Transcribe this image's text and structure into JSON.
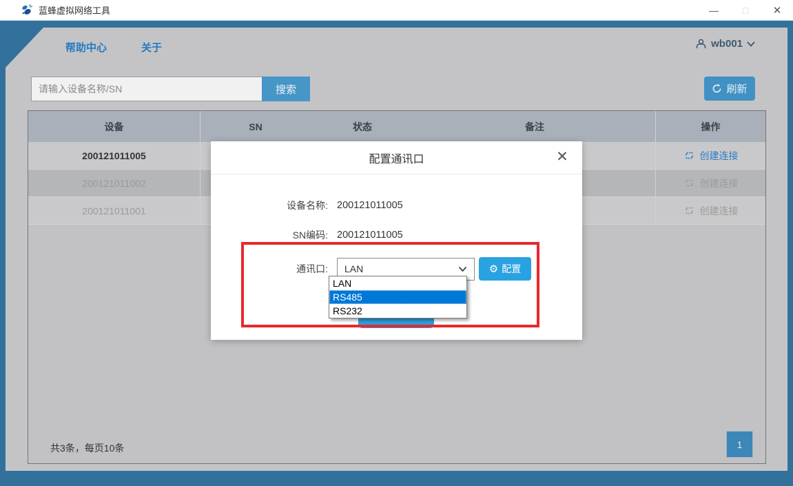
{
  "window": {
    "title": "蓝蜂虚拟网络工具",
    "controls": {
      "minimize": "—",
      "maximize": "□",
      "close": "✕"
    }
  },
  "navbar": {
    "tabs": [
      {
        "label": "帮助中心"
      },
      {
        "label": "关于"
      }
    ],
    "user": {
      "name": "wb001"
    }
  },
  "toolbar": {
    "search_placeholder": "请输入设备名称/SN",
    "search_label": "搜索",
    "refresh_label": "刷新"
  },
  "table": {
    "headers": [
      "设备",
      "SN",
      "状态",
      "备注",
      "操作"
    ],
    "rows": [
      {
        "device": "200121011005",
        "action": "创建连接",
        "enabled": true
      },
      {
        "device": "200121011002",
        "action": "创建连接",
        "enabled": false
      },
      {
        "device": "200121011001",
        "action": "创建连接",
        "enabled": false
      }
    ]
  },
  "footer": {
    "summary": "共3条，每页10条",
    "page": "1"
  },
  "modal": {
    "title": "配置通讯口",
    "close": "✕",
    "fields": [
      {
        "label": "设备名称:",
        "value": "200121011005"
      },
      {
        "label": "SN编码:",
        "value": "200121011005"
      }
    ],
    "port_label": "通讯口:",
    "select_value": "LAN",
    "options": [
      "LAN",
      "RS485",
      "RS232"
    ],
    "selected_option": "RS485",
    "config_label": "配置",
    "gear_icon": "⚙"
  },
  "colors": {
    "frame_blue": "#33719d",
    "accent_blue": "#29a2e2",
    "muted_button_blue": "#4696c8",
    "link_blue": "#2b7dc2",
    "selected_option_blue": "#0078d7",
    "highlight_red": "#e8282d",
    "table_header_gray": "#a9b0b9"
  }
}
